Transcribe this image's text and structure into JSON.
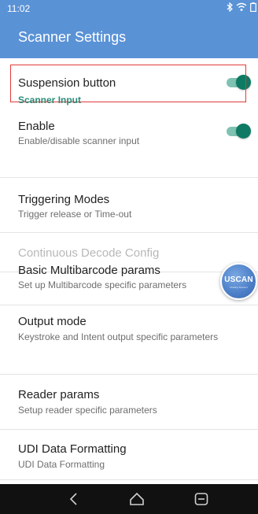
{
  "status_bar": {
    "time": "11:02",
    "icons": [
      "bluetooth-icon",
      "wifi-icon",
      "battery-icon"
    ]
  },
  "app_bar": {
    "title": "Scanner Settings"
  },
  "preferences": {
    "suspension": {
      "title": "Suspension button",
      "enabled": true
    },
    "section_scanner_input": "Scanner Input",
    "enable": {
      "title": "Enable",
      "summary": "Enable/disable scanner input",
      "enabled": true
    },
    "triggering": {
      "title": "Triggering Modes",
      "summary": "Trigger release or Time-out"
    },
    "continuous": {
      "title": "Continuous Decode Config"
    },
    "multibarcode": {
      "title": "Basic Multibarcode params",
      "summary": "Set up Multibarcode specific parameters"
    },
    "output_mode": {
      "title": "Output mode",
      "summary": "Keystroke and Intent output specific parameters"
    },
    "reader_params": {
      "title": "Reader params",
      "summary": "Setup reader specific parameters"
    },
    "udi": {
      "title": "UDI Data Formatting",
      "summary": "UDI Data Formatting"
    }
  },
  "floating_button": {
    "label": "USCAN",
    "sublabel": "Floating Scanner"
  },
  "nav_bar": {
    "buttons": [
      "back-icon",
      "home-icon",
      "recents-icon"
    ]
  },
  "colors": {
    "app_bar": "#5a92d6",
    "accent": "#0e7a63",
    "section_header": "#2a8c78",
    "highlight_border": "#e23a3a"
  }
}
